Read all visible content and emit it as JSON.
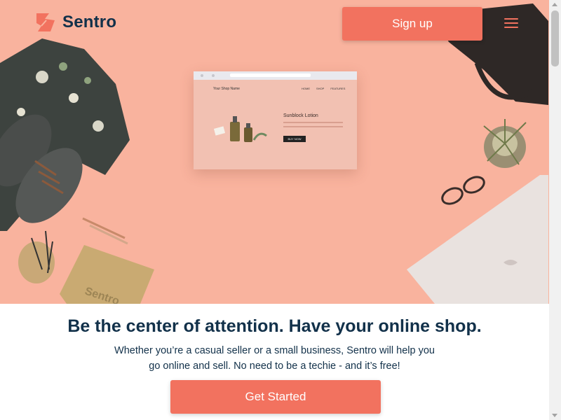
{
  "brand": {
    "name": "Sentro",
    "accent": "#f2725f",
    "navy": "#12314a",
    "hero_bg": "#f9b39e"
  },
  "header": {
    "signup_label": "Sign up"
  },
  "hero_mockup": {
    "shop_name": "Your Shop Name",
    "nav": [
      "HOME",
      "SHOP",
      "FEATURES"
    ],
    "product_title": "Sunblock Lotion",
    "buy_label": "BUY NOW"
  },
  "main": {
    "headline": "Be the center of attention. Have your online shop.",
    "subtext_line1": "Whether you’re a casual seller or a small business, Sentro will help you",
    "subtext_line2": "go online and sell. No need to be a techie - and it’s free!",
    "cta_label": "Get Started"
  }
}
